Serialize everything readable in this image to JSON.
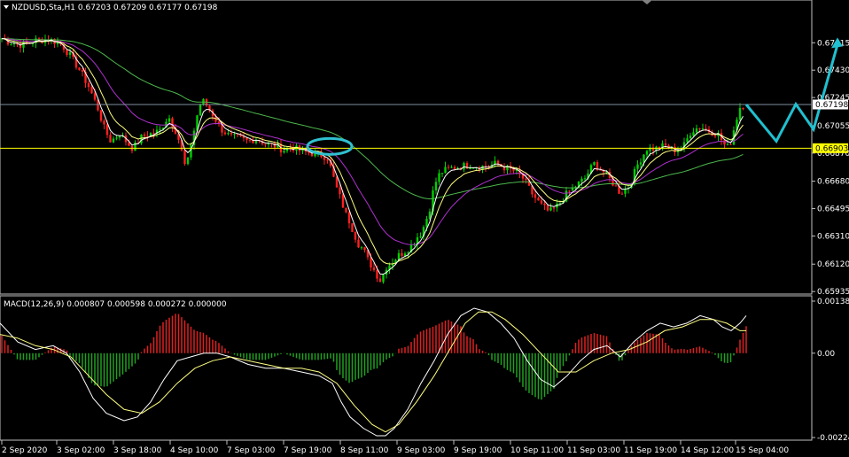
{
  "chart_data": [
    {
      "type": "candlestick",
      "panel": "price",
      "header": "NZDUSD,Sta,H1  0.67203 0.67209 0.67177 0.67198",
      "symbol": "NZDUSD,Sta,H1",
      "ohlc_last": "0.67203 0.67209 0.67177 0.67198",
      "ylim": [
        0.6593,
        0.6782
      ],
      "y_ticks": [
        "0.67615",
        "0.67430",
        "0.67245",
        "0.67055",
        "0.66870",
        "0.66680",
        "0.66495",
        "0.66310",
        "0.66120",
        "0.65935"
      ],
      "y_tick_values": [
        0.67615,
        0.6743,
        0.67245,
        0.67055,
        0.6687,
        0.6668,
        0.66495,
        0.6631,
        0.6612,
        0.65935
      ],
      "x_ticks": [
        "2 Sep 2020",
        "3 Sep 02:00",
        "3 Sep 18:00",
        "4 Sep 10:00",
        "7 Sep 03:00",
        "7 Sep 19:00",
        "8 Sep 11:00",
        "9 Sep 03:00",
        "9 Sep 19:00",
        "10 Sep 11:00",
        "11 Sep 03:00",
        "11 Sep 19:00",
        "14 Sep 12:00",
        "15 Sep 04:00"
      ],
      "price_labels": {
        "current": "0.67198",
        "level": "0.66903"
      },
      "current_price": 0.67198,
      "horizontal_level": 0.66903,
      "price_path": [
        [
          0,
          0.6765
        ],
        [
          10,
          0.6762
        ],
        [
          25,
          0.676
        ],
        [
          40,
          0.6763
        ],
        [
          55,
          0.6764
        ],
        [
          70,
          0.676
        ],
        [
          80,
          0.6752
        ],
        [
          90,
          0.6743
        ],
        [
          100,
          0.6732
        ],
        [
          110,
          0.6718
        ],
        [
          118,
          0.6703
        ],
        [
          125,
          0.6695
        ],
        [
          135,
          0.67
        ],
        [
          145,
          0.6693
        ],
        [
          150,
          0.669
        ],
        [
          160,
          0.6698
        ],
        [
          170,
          0.67
        ],
        [
          180,
          0.6702
        ],
        [
          190,
          0.6712
        ],
        [
          200,
          0.67
        ],
        [
          205,
          0.6688
        ],
        [
          210,
          0.6675
        ],
        [
          215,
          0.6692
        ],
        [
          220,
          0.6705
        ],
        [
          225,
          0.672
        ],
        [
          230,
          0.6722
        ],
        [
          240,
          0.6713
        ],
        [
          250,
          0.6703
        ],
        [
          260,
          0.6698
        ],
        [
          270,
          0.6697
        ],
        [
          280,
          0.6695
        ],
        [
          290,
          0.6697
        ],
        [
          300,
          0.6693
        ],
        [
          310,
          0.6692
        ],
        [
          320,
          0.6689
        ],
        [
          330,
          0.6691
        ],
        [
          340,
          0.6688
        ],
        [
          350,
          0.6687
        ],
        [
          360,
          0.6686
        ],
        [
          370,
          0.6684
        ],
        [
          375,
          0.6673
        ],
        [
          380,
          0.6663
        ],
        [
          385,
          0.6655
        ],
        [
          390,
          0.6646
        ],
        [
          395,
          0.664
        ],
        [
          400,
          0.6632
        ],
        [
          405,
          0.6625
        ],
        [
          410,
          0.6622
        ],
        [
          415,
          0.6615
        ],
        [
          420,
          0.661
        ],
        [
          425,
          0.6605
        ],
        [
          430,
          0.66
        ],
        [
          435,
          0.661
        ],
        [
          440,
          0.6612
        ],
        [
          445,
          0.6615
        ],
        [
          450,
          0.6618
        ],
        [
          455,
          0.662
        ],
        [
          460,
          0.6622
        ],
        [
          465,
          0.6625
        ],
        [
          470,
          0.663
        ],
        [
          475,
          0.6633
        ],
        [
          480,
          0.664
        ],
        [
          485,
          0.665
        ],
        [
          490,
          0.6665
        ],
        [
          495,
          0.6672
        ],
        [
          500,
          0.6675
        ],
        [
          510,
          0.6677
        ],
        [
          520,
          0.6678
        ],
        [
          530,
          0.6679
        ],
        [
          540,
          0.6678
        ],
        [
          550,
          0.6678
        ],
        [
          560,
          0.668
        ],
        [
          570,
          0.6677
        ],
        [
          580,
          0.6675
        ],
        [
          590,
          0.667
        ],
        [
          600,
          0.666
        ],
        [
          610,
          0.6652
        ],
        [
          620,
          0.6647
        ],
        [
          630,
          0.6652
        ],
        [
          640,
          0.666
        ],
        [
          650,
          0.6665
        ],
        [
          660,
          0.667
        ],
        [
          670,
          0.668
        ],
        [
          680,
          0.6675
        ],
        [
          690,
          0.6668
        ],
        [
          700,
          0.666
        ],
        [
          710,
          0.6665
        ],
        [
          720,
          0.668
        ],
        [
          730,
          0.669
        ],
        [
          740,
          0.669
        ],
        [
          750,
          0.6692
        ],
        [
          760,
          0.6689
        ],
        [
          770,
          0.669
        ],
        [
          780,
          0.6702
        ],
        [
          790,
          0.6705
        ],
        [
          800,
          0.6702
        ],
        [
          810,
          0.67
        ],
        [
          820,
          0.669
        ],
        [
          825,
          0.6695
        ],
        [
          830,
          0.6708
        ],
        [
          835,
          0.6718
        ],
        [
          840,
          0.672
        ]
      ],
      "forecast_path": [
        [
          842,
          0.67198
        ],
        [
          876,
          0.6695
        ],
        [
          898,
          0.672
        ],
        [
          918,
          0.6703
        ],
        [
          945,
          0.6765
        ]
      ]
    },
    {
      "type": "macd",
      "panel": "indicator",
      "header": "MACD(12,26,9) 0.000807 0.000598 0.000272 0.000000",
      "params": "MACD(12,26,9)",
      "values_text": "0.000807 0.000598 0.000272 0.000000",
      "ylim": [
        -0.002248,
        0.001388
      ],
      "y_ticks": [
        "0.001388",
        "0.00",
        "-0.002248"
      ],
      "y_tick_values": [
        0.001388,
        0.0,
        -0.002248
      ],
      "macd_path": [
        [
          0,
          0.0008
        ],
        [
          20,
          0.0003
        ],
        [
          40,
          0.0001
        ],
        [
          60,
          0.0002
        ],
        [
          75,
          0.0
        ],
        [
          90,
          -0.0005
        ],
        [
          105,
          -0.0012
        ],
        [
          120,
          -0.0016
        ],
        [
          140,
          -0.0018
        ],
        [
          155,
          -0.0017
        ],
        [
          170,
          -0.0013
        ],
        [
          185,
          -0.0007
        ],
        [
          200,
          -0.0002
        ],
        [
          215,
          -0.0001
        ],
        [
          230,
          0.0
        ],
        [
          245,
          0.0
        ],
        [
          260,
          -0.0001
        ],
        [
          280,
          -0.0003
        ],
        [
          300,
          -0.0004
        ],
        [
          320,
          -0.0004
        ],
        [
          340,
          -0.0005
        ],
        [
          360,
          -0.0006
        ],
        [
          375,
          -0.0008
        ],
        [
          385,
          -0.0013
        ],
        [
          395,
          -0.0017
        ],
        [
          410,
          -0.002
        ],
        [
          425,
          -0.0022
        ],
        [
          435,
          -0.0022
        ],
        [
          445,
          -0.002
        ],
        [
          460,
          -0.0015
        ],
        [
          475,
          -0.0008
        ],
        [
          490,
          -0.0002
        ],
        [
          505,
          0.0005
        ],
        [
          520,
          0.001
        ],
        [
          535,
          0.0012
        ],
        [
          550,
          0.0011
        ],
        [
          565,
          0.0008
        ],
        [
          580,
          0.0004
        ],
        [
          595,
          -0.0002
        ],
        [
          610,
          -0.0007
        ],
        [
          625,
          -0.0009
        ],
        [
          640,
          -0.0006
        ],
        [
          655,
          -0.0002
        ],
        [
          670,
          0.0001
        ],
        [
          685,
          0.0002
        ],
        [
          700,
          -0.0001
        ],
        [
          715,
          0.0003
        ],
        [
          730,
          0.0006
        ],
        [
          745,
          0.0008
        ],
        [
          760,
          0.0007
        ],
        [
          775,
          0.0008
        ],
        [
          790,
          0.001
        ],
        [
          805,
          0.0009
        ],
        [
          815,
          0.0007
        ],
        [
          825,
          0.0006
        ],
        [
          835,
          0.0008
        ],
        [
          842,
          0.001
        ]
      ],
      "signal_path": [
        [
          0,
          0.0005
        ],
        [
          20,
          0.0004
        ],
        [
          40,
          0.0002
        ],
        [
          60,
          0.0001
        ],
        [
          80,
          -0.0001
        ],
        [
          100,
          -0.0006
        ],
        [
          120,
          -0.0011
        ],
        [
          140,
          -0.0015
        ],
        [
          160,
          -0.0016
        ],
        [
          180,
          -0.0013
        ],
        [
          200,
          -0.0008
        ],
        [
          220,
          -0.0004
        ],
        [
          240,
          -0.0002
        ],
        [
          260,
          -0.0001
        ],
        [
          280,
          -0.0002
        ],
        [
          300,
          -0.0003
        ],
        [
          320,
          -0.0004
        ],
        [
          340,
          -0.0004
        ],
        [
          360,
          -0.0005
        ],
        [
          380,
          -0.0008
        ],
        [
          400,
          -0.0014
        ],
        [
          420,
          -0.0019
        ],
        [
          435,
          -0.0021
        ],
        [
          450,
          -0.0019
        ],
        [
          470,
          -0.0013
        ],
        [
          490,
          -0.0006
        ],
        [
          510,
          0.0002
        ],
        [
          525,
          0.0008
        ],
        [
          540,
          0.0011
        ],
        [
          555,
          0.0011
        ],
        [
          570,
          0.0009
        ],
        [
          590,
          0.0005
        ],
        [
          610,
          0.0
        ],
        [
          630,
          -0.0005
        ],
        [
          650,
          -0.0005
        ],
        [
          670,
          -0.0002
        ],
        [
          690,
          0.0
        ],
        [
          710,
          0.0001
        ],
        [
          730,
          0.0003
        ],
        [
          750,
          0.0006
        ],
        [
          770,
          0.0007
        ],
        [
          790,
          0.0009
        ],
        [
          805,
          0.0009
        ],
        [
          820,
          0.0008
        ],
        [
          835,
          0.0006
        ],
        [
          842,
          0.0006
        ]
      ]
    }
  ]
}
